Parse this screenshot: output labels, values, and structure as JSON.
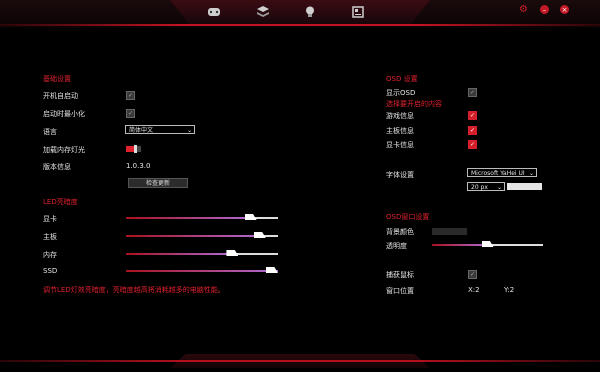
{
  "nav": {
    "icons": [
      "controller-icon",
      "layers-icon",
      "bulb-icon",
      "monitor-settings-icon"
    ],
    "window_buttons": [
      "settings-icon",
      "minimize-icon",
      "close-icon"
    ]
  },
  "basic": {
    "title": "基础设置",
    "autostart_label": "开机自启动",
    "autostart_checked": true,
    "minimize_label": "启动时最小化",
    "minimize_checked": true,
    "language_label": "语言",
    "language_value": "简体中文",
    "memory_light_label": "加载内存灯光",
    "memory_light_on": true,
    "version_label": "版本信息",
    "version_value": "1.0.3.0",
    "check_update_label": "检查更新"
  },
  "led": {
    "title": "LED亮暗度",
    "items": [
      {
        "label": "显卡",
        "level": 0.82
      },
      {
        "label": "主板",
        "level": 0.88
      },
      {
        "label": "内存",
        "level": 0.7
      },
      {
        "label": "SSD",
        "level": 1.0
      }
    ],
    "note": "调节LED灯效亮暗度，亮暗度越高将消耗越多的电脑性能。"
  },
  "osd": {
    "title": "OSD 设置",
    "show_osd_label": "显示OSD",
    "show_osd_checked": true,
    "choose_label": "选择要开启的内容",
    "options": [
      {
        "label": "游戏信息",
        "checked": true
      },
      {
        "label": "主板信息",
        "checked": true
      },
      {
        "label": "显卡信息",
        "checked": true
      }
    ],
    "font_label": "字体设置",
    "font_value": "Microsoft YaHei UI",
    "size_value": "20 px",
    "font_color": "#e6e6e6"
  },
  "osd_window": {
    "title": "OSD窗口设置",
    "bg_color_label": "背景颜色",
    "bg_color": "#2a2a2a",
    "transparency_label": "透明度",
    "transparency_level": 0.5,
    "capture_mouse_label": "捕获鼠标",
    "capture_mouse_checked": true,
    "position_label": "窗口位置",
    "x_text": "X:2",
    "y_text": "Y:2"
  },
  "colors": {
    "accent": "#e0222e",
    "background": "#000000"
  }
}
